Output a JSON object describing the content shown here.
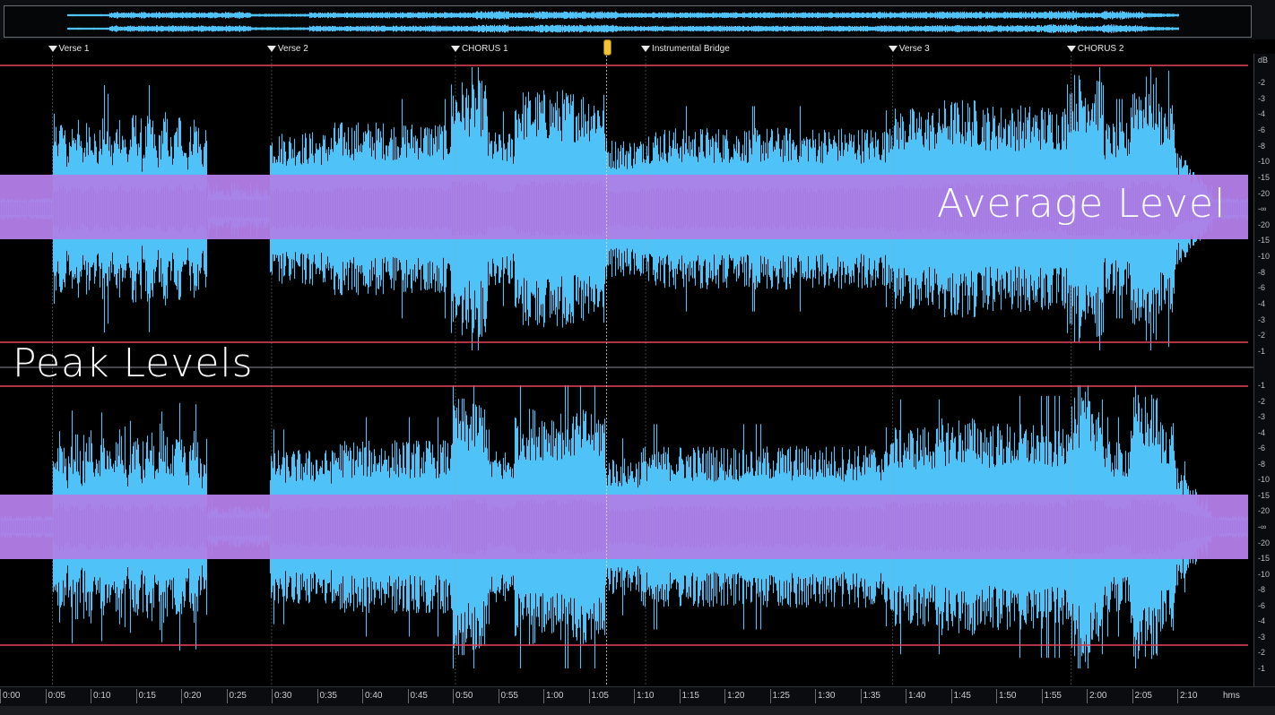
{
  "markers": [
    {
      "label": "Verse 1",
      "t": 5.0
    },
    {
      "label": "Verse 2",
      "t": 29.2
    },
    {
      "label": "CHORUS 1",
      "t": 49.5
    },
    {
      "label": "Instrumental Bridge",
      "t": 70.5
    },
    {
      "label": "Verse 3",
      "t": 97.8
    },
    {
      "label": "CHORUS 2",
      "t": 117.5
    }
  ],
  "playhead_time": 66.2,
  "annotations": {
    "average_level": "Average Level",
    "peak_levels": "Peak Levels"
  },
  "db_scale": {
    "unit": "dB",
    "top_channel_ticks": [
      "-2",
      "-3",
      "-4",
      "-6",
      "-8",
      "-10",
      "-15",
      "-20",
      "-∞",
      "-20",
      "-15",
      "-10",
      "-8",
      "-6",
      "-4",
      "-3",
      "-2",
      "-1"
    ],
    "bottom_channel_ticks": [
      "-1",
      "-2",
      "-3",
      "-4",
      "-6",
      "-8",
      "-10",
      "-15",
      "-20",
      "-∞",
      "-20",
      "-15",
      "-10",
      "-8",
      "-6",
      "-4",
      "-3",
      "-2",
      "-1"
    ]
  },
  "timeline": {
    "labels": [
      "0:00",
      "0:05",
      "0:10",
      "0:15",
      "0:20",
      "0:25",
      "0:30",
      "0:35",
      "0:40",
      "0:45",
      "0:50",
      "0:55",
      "1:00",
      "1:05",
      "1:10",
      "1:15",
      "1:20",
      "1:25",
      "1:30",
      "1:35",
      "1:40",
      "1:45",
      "1:50",
      "1:55",
      "2:00",
      "2:05",
      "2:10"
    ],
    "unit": "hms"
  },
  "colors": {
    "background": "#000000",
    "peak_waveform": "#4fc3f7",
    "average_band": "#b07fe6",
    "band_outside": "#6b2563",
    "limit_lines": "#e8465a",
    "marker_text": "#e6e6e6",
    "playhead": "#f1c232"
  }
}
